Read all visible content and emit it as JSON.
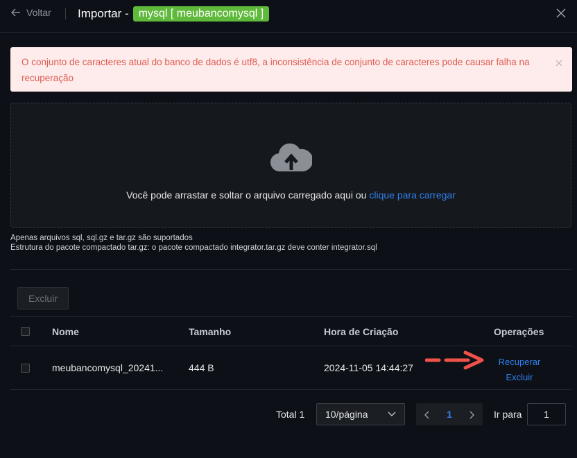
{
  "header": {
    "back_label": "Voltar",
    "title_prefix": "Importar -",
    "db_tag": "mysql [ meubancomysql ]"
  },
  "alert": {
    "message": "O conjunto de caracteres atual do banco de dados é utf8, a inconsistência de conjunto de caracteres pode causar falha na recuperação"
  },
  "upload": {
    "text": "Você pode arrastar e soltar o arquivo carregado aqui ou",
    "link": "clique para carregar",
    "hint1": "Apenas arquivos sql, sql.gz e tar.gz são suportados",
    "hint2": "Estrutura do pacote compactado tar.gz: o pacote compactado integrator.tar.gz deve conter integrator.sql"
  },
  "toolbar": {
    "delete_label": "Excluir"
  },
  "table": {
    "columns": [
      "Nome",
      "Tamanho",
      "Hora de Criação",
      "Operações"
    ],
    "rows": [
      {
        "name": "meubancomysql_20241...",
        "size": "444 B",
        "created": "2024-11-05 14:44:27",
        "op_restore": "Recuperar",
        "op_delete": "Excluir"
      }
    ]
  },
  "pagination": {
    "total": "Total 1",
    "page_size": "10/página",
    "current_page": "1",
    "goto_label": "Ir para",
    "goto_value": "1"
  },
  "colors": {
    "tag": "#5fb93a",
    "link": "#2f80ed",
    "alert_bg": "#fdeceb",
    "alert_text": "#e05a50",
    "annotation_arrow": "#f0524a"
  }
}
